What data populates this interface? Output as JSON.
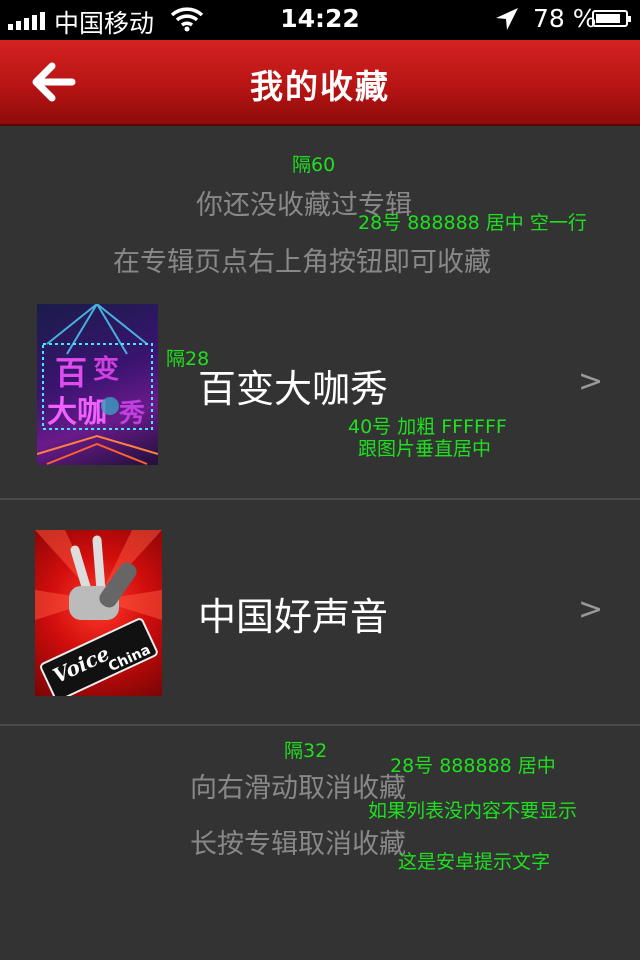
{
  "status_bar": {
    "carrier": "中国移动",
    "time": "14:22",
    "battery_text": "78 %",
    "battery_level": 0.78
  },
  "nav": {
    "title": "我的收藏",
    "back_icon": "arrow-left-icon"
  },
  "empty_hint": {
    "line1": "你还没收藏过专辑",
    "line2": "在专辑页点右上角按钮即可收藏"
  },
  "items": [
    {
      "name": "百变大咖秀",
      "chevron": ">"
    },
    {
      "name": "中国好声音",
      "chevron": ">"
    }
  ],
  "bottom_hint": {
    "line1": "向右滑动取消收藏",
    "line2": "长按专辑取消收藏"
  },
  "annotations": {
    "gap60": "隔60",
    "hint_spec": "28号 888888  居中  空一行",
    "gap28": "隔28",
    "title_spec1": "40号 加粗 FFFFFF",
    "title_spec2": "跟图片垂直居中",
    "gap32": "隔32",
    "bottom_spec1": "28号 888888  居中",
    "bottom_spec2": "如果列表没内容不要显示",
    "bottom_spec3": "这是安卓提示文字"
  },
  "colors": {
    "background": "#333333",
    "nav_red": "#c01818",
    "hint_text": "#888888",
    "item_text": "#FFFFFF",
    "annotation": "#1fe01f"
  }
}
